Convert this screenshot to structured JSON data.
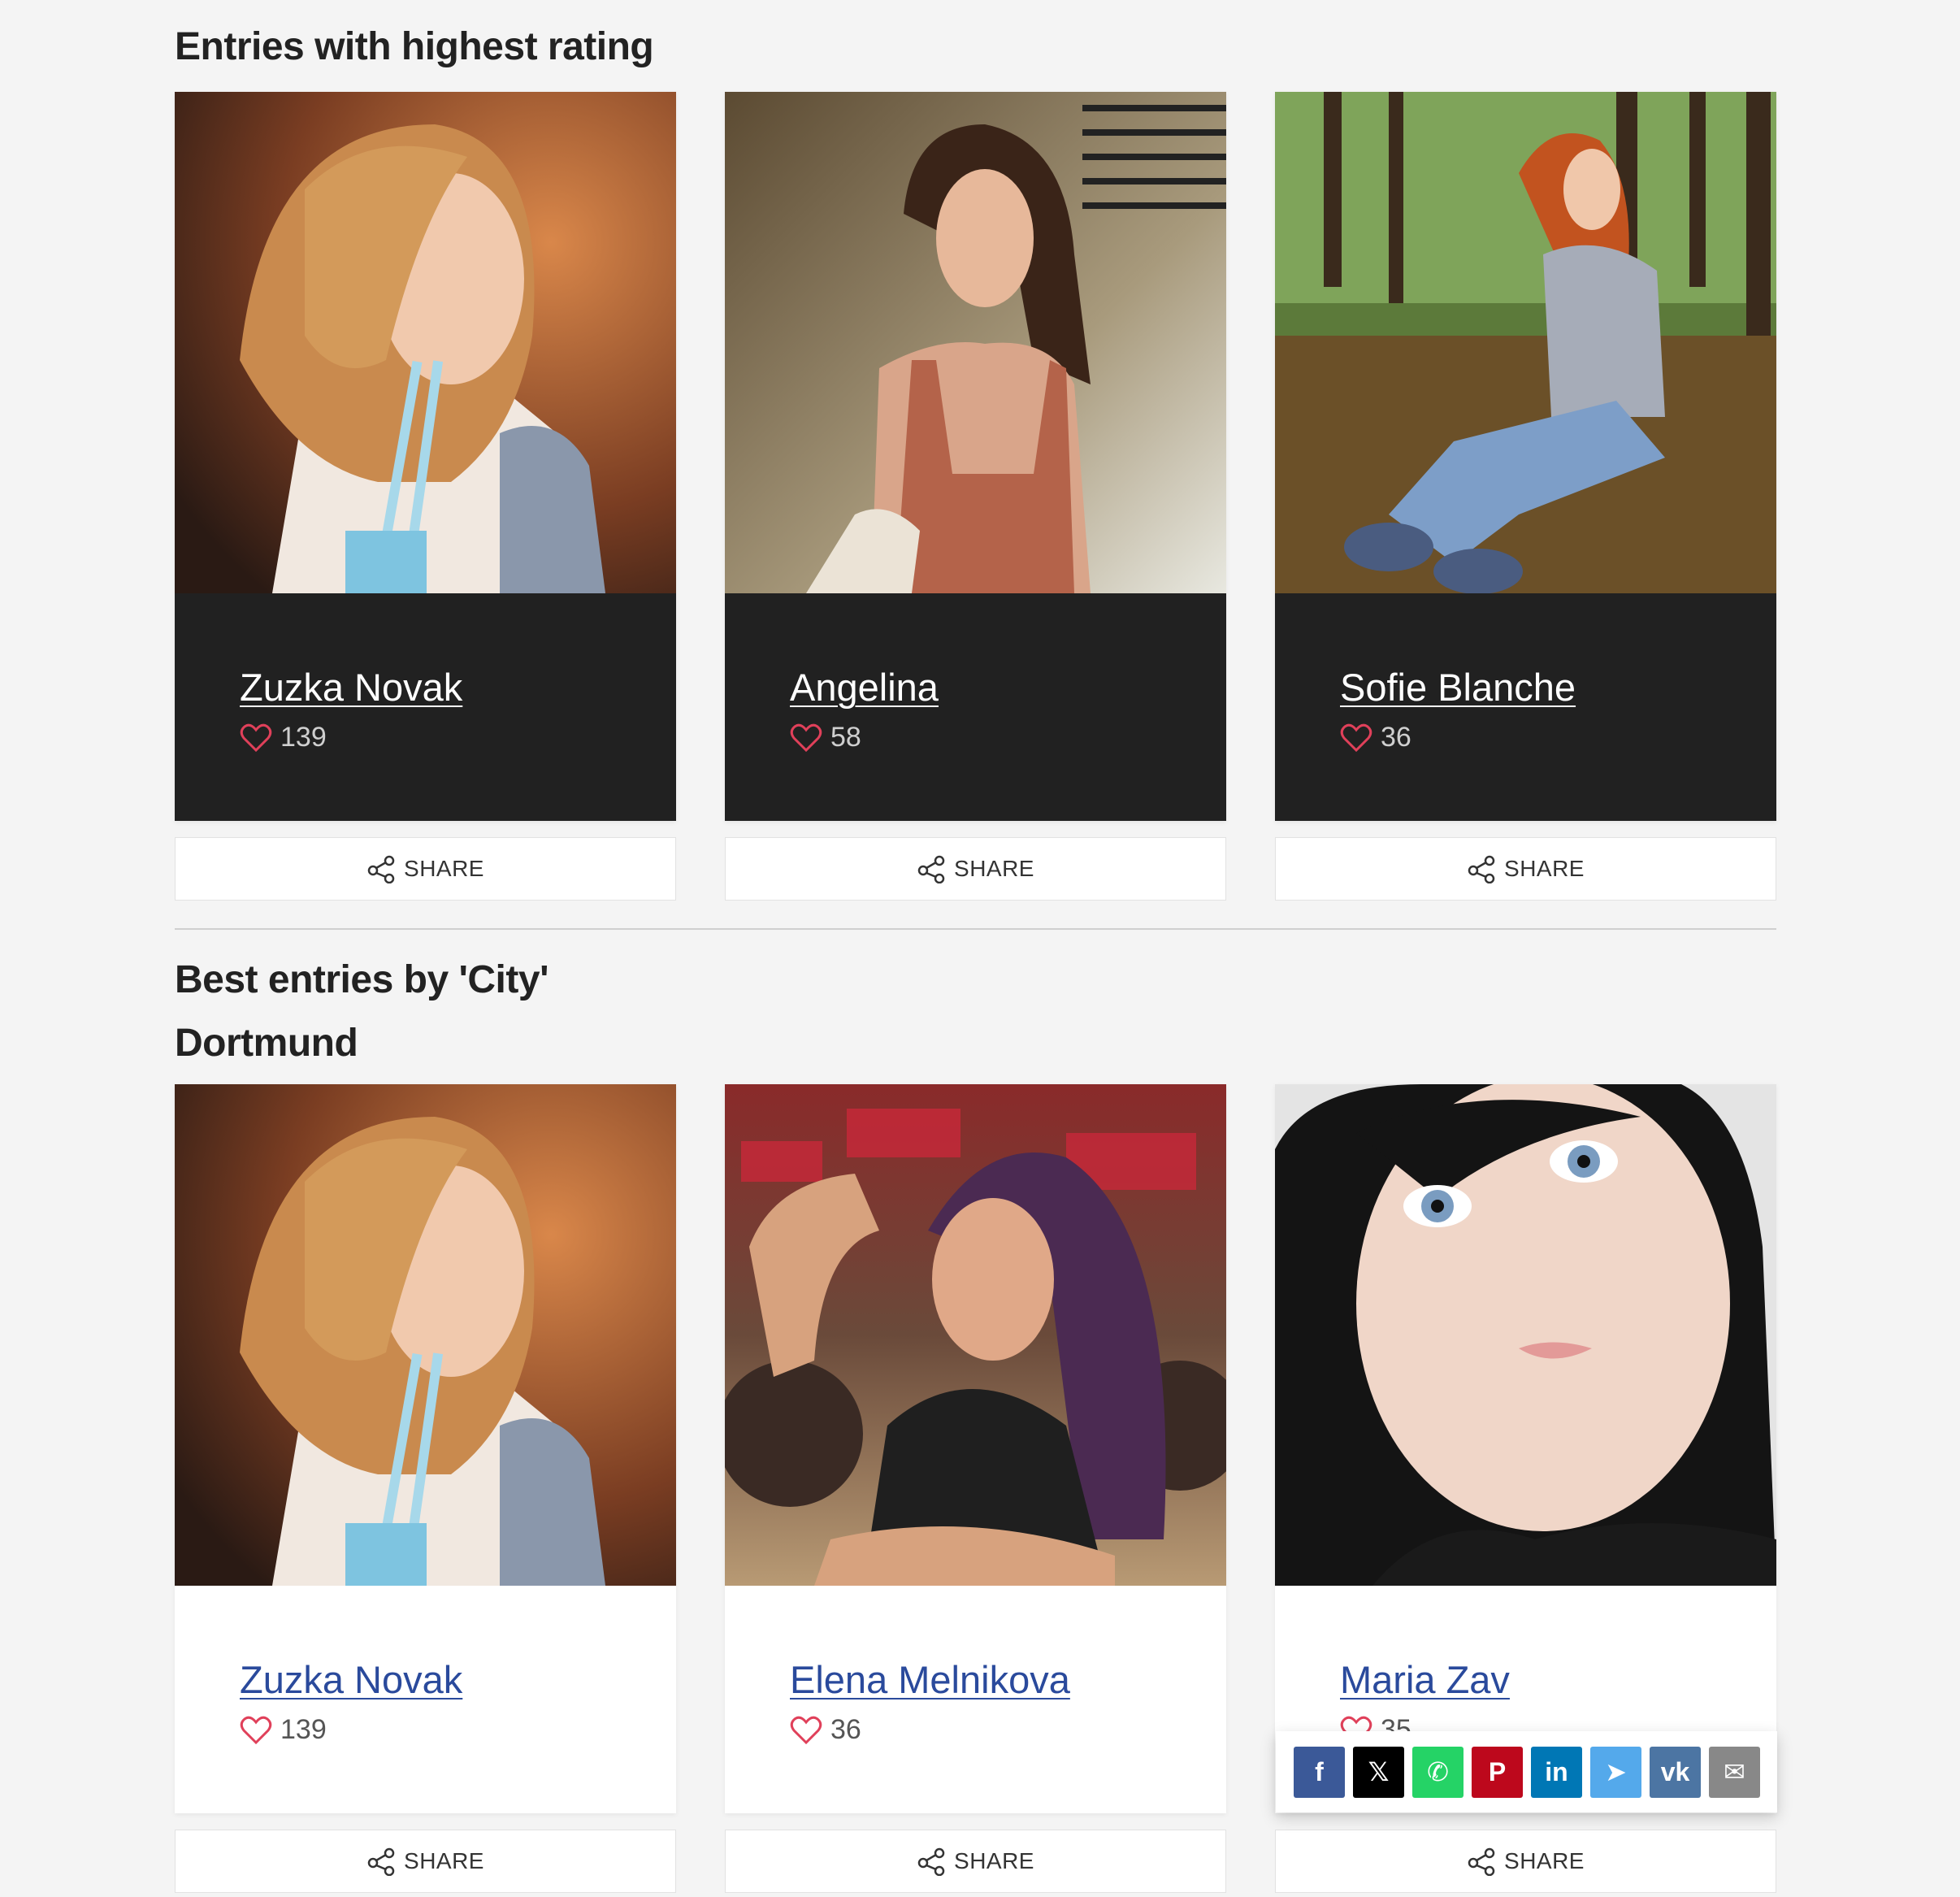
{
  "sections": {
    "top_rated": {
      "title": "Entries with highest rating"
    },
    "by_city": {
      "title": "Best entries by 'City'",
      "subtitle": "Dortmund"
    }
  },
  "top_entries": [
    {
      "name": "Zuzka Novak",
      "likes": "139"
    },
    {
      "name": "Angelina",
      "likes": "58"
    },
    {
      "name": "Sofie Blanche",
      "likes": "36"
    }
  ],
  "city_entries": [
    {
      "name": "Zuzka Novak",
      "likes": "139"
    },
    {
      "name": "Elena Melnikova",
      "likes": "36"
    },
    {
      "name": "Maria Zav",
      "likes": "35"
    }
  ],
  "share": {
    "label": "SHARE"
  },
  "share_popup": {
    "items": [
      {
        "name": "facebook",
        "glyph": "f",
        "color": "#3b5998"
      },
      {
        "name": "x",
        "glyph": "𝕏",
        "color": "#000000"
      },
      {
        "name": "whatsapp",
        "glyph": "✆",
        "color": "#25d366"
      },
      {
        "name": "pinterest",
        "glyph": "P",
        "color": "#bd081c"
      },
      {
        "name": "linkedin",
        "glyph": "in",
        "color": "#0077b5"
      },
      {
        "name": "telegram",
        "glyph": "➤",
        "color": "#54a9eb"
      },
      {
        "name": "vk",
        "glyph": "vk",
        "color": "#4c75a3"
      },
      {
        "name": "email",
        "glyph": "✉",
        "color": "#888888"
      }
    ]
  },
  "colors": {
    "heart": "#e0405a",
    "link_light": "#2a4a9c",
    "card_dark": "#212121"
  }
}
